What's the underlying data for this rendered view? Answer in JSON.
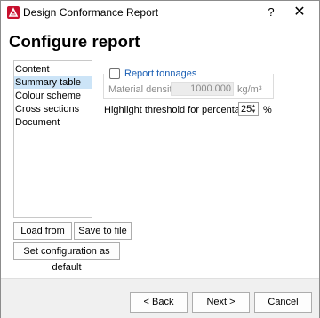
{
  "window": {
    "title": "Design Conformance Report",
    "help_label": "?",
    "close_label": "✕"
  },
  "page": {
    "heading": "Configure report"
  },
  "nav": {
    "items": [
      {
        "label": "Content",
        "selected": false
      },
      {
        "label": "Summary table",
        "selected": true
      },
      {
        "label": "Colour scheme",
        "selected": false
      },
      {
        "label": "Cross sections",
        "selected": false
      },
      {
        "label": "Document",
        "selected": false
      }
    ]
  },
  "summary": {
    "report_tonnages_label": "Report tonnages",
    "report_tonnages_checked": false,
    "material_density_label": "Material density",
    "material_density_value": "1000.000",
    "material_density_unit": "kg/m³",
    "highlight_threshold_label": "Highlight threshold for percentages",
    "highlight_threshold_value": "25",
    "highlight_threshold_unit": "%"
  },
  "actions": {
    "load_label": "Load from file",
    "save_label": "Save to file",
    "default_label": "Set configuration as default"
  },
  "footer": {
    "back_label": "< Back",
    "next_label": "Next >",
    "cancel_label": "Cancel"
  },
  "colors": {
    "accent": "#c8102e",
    "selection": "#cce4f7",
    "link": "#1a5fb4"
  },
  "icons": {
    "app": "app-logo-icon",
    "spin_up": "spin-up-icon",
    "spin_down": "spin-down-icon"
  }
}
